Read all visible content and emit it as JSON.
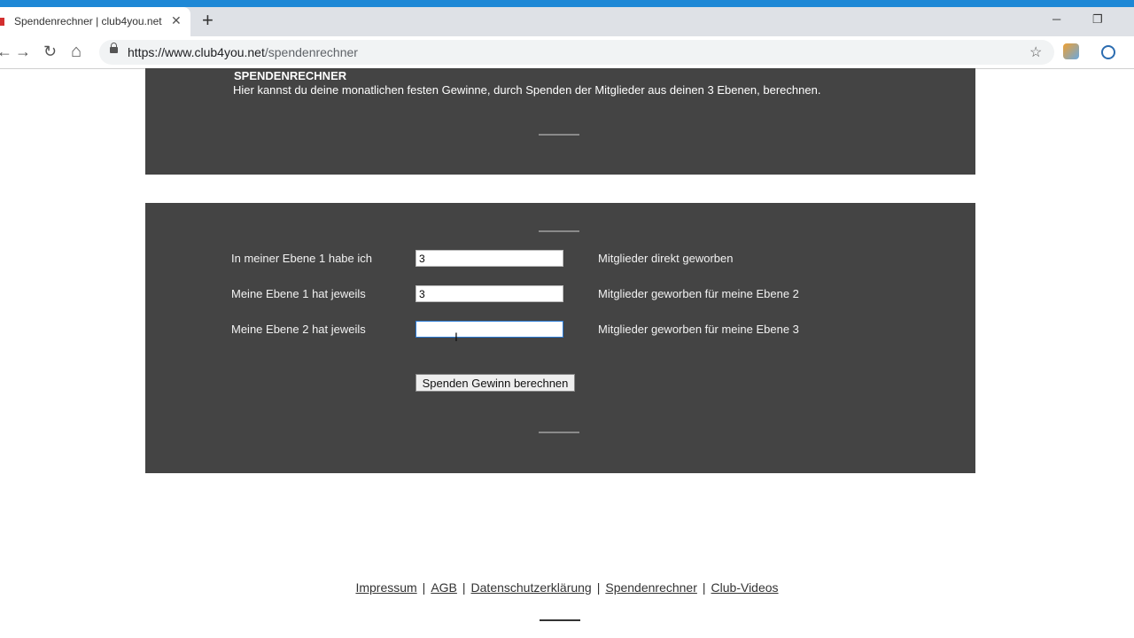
{
  "browser": {
    "tab_title": "Spendenrechner | club4you.net",
    "tab_close": "✕",
    "new_tab": "+",
    "url_domain": "https://www.club4you.net",
    "url_path": "/spendenrechner",
    "bookmark_star": "☆",
    "nav_back": "←",
    "nav_forward": "→",
    "nav_reload": "↻",
    "nav_home": "⌂",
    "win_minimize": "─",
    "win_restore": "❐"
  },
  "intro": {
    "heading": "SPENDENRECHNER",
    "text": "Hier kannst du deine monatlichen festen Gewinne, durch Spenden der Mitglieder aus deinen 3 Ebenen, berechnen."
  },
  "form": {
    "rows": [
      {
        "label": "In meiner Ebene 1 habe ich",
        "value": "3",
        "suffix": "Mitglieder direkt geworben"
      },
      {
        "label": "Meine Ebene 1 hat jeweils",
        "value": "3",
        "suffix": "Mitglieder geworben für meine Ebene 2"
      },
      {
        "label": "Meine Ebene 2 hat jeweils",
        "value": "",
        "suffix": "Mitglieder geworben für meine Ebene 3"
      }
    ],
    "button_label": "Spenden Gewinn berechnen",
    "cursor": "I"
  },
  "footer": {
    "links": [
      "Impressum",
      "AGB",
      "Datenschutzerklärung",
      "Spendenrechner",
      "Club-Videos"
    ],
    "separator": "|"
  },
  "colors": {
    "panel_bg": "#444444",
    "chrome_accent": "#1e88d6"
  }
}
